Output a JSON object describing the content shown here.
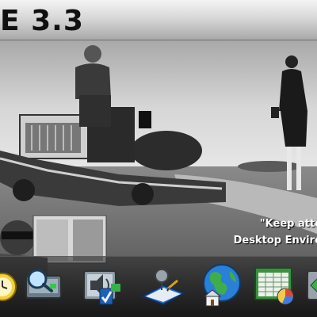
{
  "window": {
    "title": "E 3.3"
  },
  "wallpaper": {
    "quote_line1": "\"Keep atte",
    "quote_line2": "Desktop Enviro"
  },
  "dock": {
    "items": [
      {
        "icon": "clock-icon"
      },
      {
        "icon": "search-icon"
      },
      {
        "icon": "multimedia-icon"
      },
      {
        "icon": "drawing-icon"
      },
      {
        "icon": "globe-home-icon"
      },
      {
        "icon": "spreadsheet-icon"
      },
      {
        "icon": "arrow-icon"
      }
    ]
  },
  "colors": {
    "titlebar_top": "#f4f4f4",
    "titlebar_bottom": "#a9a9a9",
    "quote_text": "#ffffff"
  }
}
